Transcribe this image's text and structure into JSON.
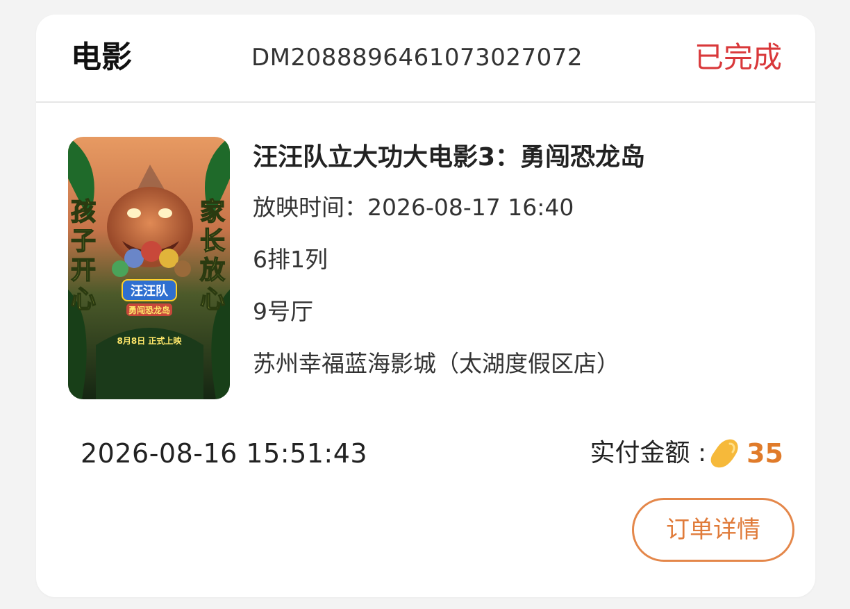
{
  "order": {
    "category": "电影",
    "order_no": "DM2088896461073027072",
    "status": "已完成",
    "status_color": "#d9383a"
  },
  "movie": {
    "title": "汪汪队立大功大电影3：勇闯恐龙岛",
    "showtime": "放映时间：2026-08-17 16:40",
    "seat": "6排1列",
    "hall": "9号厅",
    "cinema": "苏州幸福蓝海影城（太湖度假区店）"
  },
  "poster": {
    "left_text": "孩子开心",
    "right_text": "家长放心",
    "logo_text": "汪汪队",
    "subtitle_text": "勇闯恐龙岛",
    "release_text": "8月8日 正式上映"
  },
  "payment": {
    "order_time": "2026-08-16 15:51:43",
    "paid_label": "实付金额 :",
    "currency_icon": "bean-icon",
    "amount": "35",
    "accent_color": "#e07b2a"
  },
  "actions": {
    "detail_label": "订单详情"
  }
}
